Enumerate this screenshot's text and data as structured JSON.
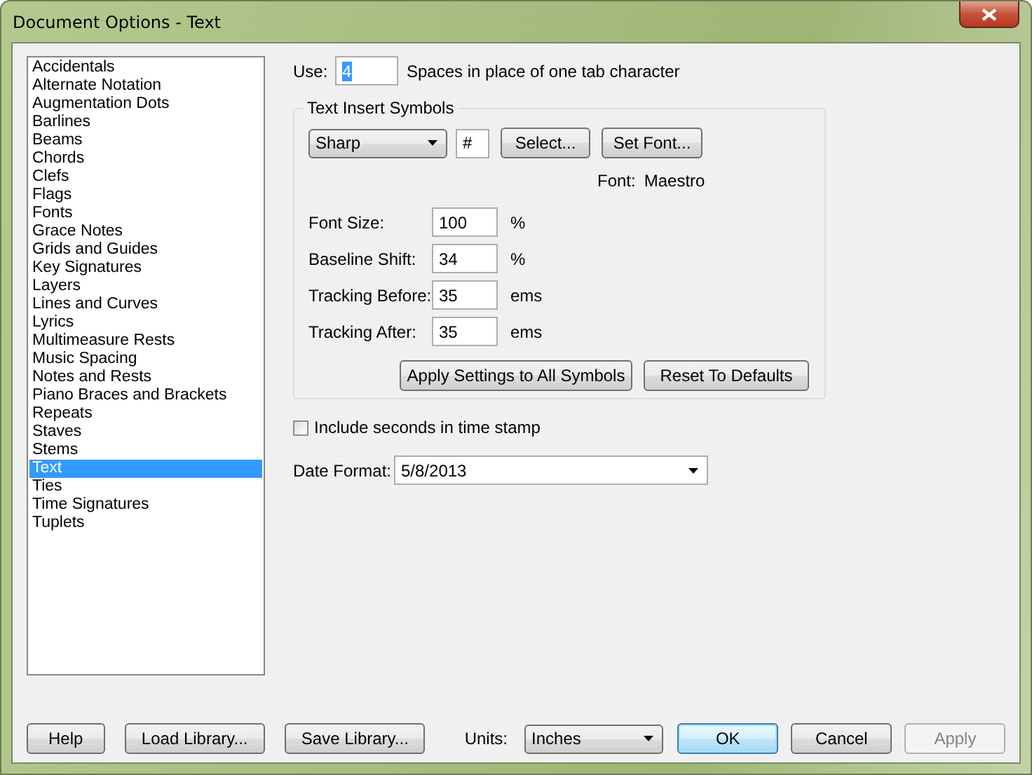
{
  "window": {
    "title": "Document Options - Text"
  },
  "categories": [
    {
      "label": "Accidentals",
      "selected": false
    },
    {
      "label": "Alternate Notation",
      "selected": false
    },
    {
      "label": "Augmentation Dots",
      "selected": false
    },
    {
      "label": "Barlines",
      "selected": false
    },
    {
      "label": "Beams",
      "selected": false
    },
    {
      "label": "Chords",
      "selected": false
    },
    {
      "label": "Clefs",
      "selected": false
    },
    {
      "label": "Flags",
      "selected": false
    },
    {
      "label": "Fonts",
      "selected": false
    },
    {
      "label": "Grace Notes",
      "selected": false
    },
    {
      "label": "Grids and Guides",
      "selected": false
    },
    {
      "label": "Key Signatures",
      "selected": false
    },
    {
      "label": "Layers",
      "selected": false
    },
    {
      "label": "Lines and Curves",
      "selected": false
    },
    {
      "label": "Lyrics",
      "selected": false
    },
    {
      "label": "Multimeasure Rests",
      "selected": false
    },
    {
      "label": "Music Spacing",
      "selected": false
    },
    {
      "label": "Notes and Rests",
      "selected": false
    },
    {
      "label": "Piano Braces and Brackets",
      "selected": false
    },
    {
      "label": "Repeats",
      "selected": false
    },
    {
      "label": "Staves",
      "selected": false
    },
    {
      "label": "Stems",
      "selected": false
    },
    {
      "label": "Text",
      "selected": true
    },
    {
      "label": "Ties",
      "selected": false
    },
    {
      "label": "Time Signatures",
      "selected": false
    },
    {
      "label": "Tuplets",
      "selected": false
    }
  ],
  "use": {
    "label": "Use:",
    "value": "4",
    "text_selected": true,
    "suffix": "Spaces in place of one tab character"
  },
  "text_insert_symbols": {
    "title": "Text Insert Symbols",
    "symbol": "Sharp",
    "character": "#",
    "select_button": "Select...",
    "set_font_button": "Set Font...",
    "font_label": "Font:",
    "font_name": "Maestro",
    "fields": [
      {
        "label": "Font Size:",
        "value": "100",
        "unit": "%"
      },
      {
        "label": "Baseline Shift:",
        "value": "34",
        "unit": "%"
      },
      {
        "label": "Tracking Before:",
        "value": "35",
        "unit": "ems"
      },
      {
        "label": "Tracking After:",
        "value": "35",
        "unit": "ems"
      }
    ],
    "apply_button": "Apply Settings to All Symbols",
    "reset_button": "Reset To Defaults"
  },
  "timestamp": {
    "label": "Include seconds in time stamp",
    "checked": false
  },
  "date_format": {
    "label": "Date Format:",
    "value": "5/8/2013"
  },
  "footer": [
    {
      "kind": "button",
      "label": "Help",
      "default": false,
      "disabled": false
    },
    {
      "kind": "button",
      "label": "Load Library...",
      "default": false,
      "disabled": false
    },
    {
      "kind": "button",
      "label": "Save Library...",
      "default": false,
      "disabled": false
    },
    {
      "kind": "dropdown",
      "label": "Units:",
      "value": "Inches"
    },
    {
      "kind": "button",
      "label": "OK",
      "default": true,
      "disabled": false
    },
    {
      "kind": "button",
      "label": "Cancel",
      "default": false,
      "disabled": false
    },
    {
      "kind": "button",
      "label": "Apply",
      "default": false,
      "disabled": true
    }
  ]
}
